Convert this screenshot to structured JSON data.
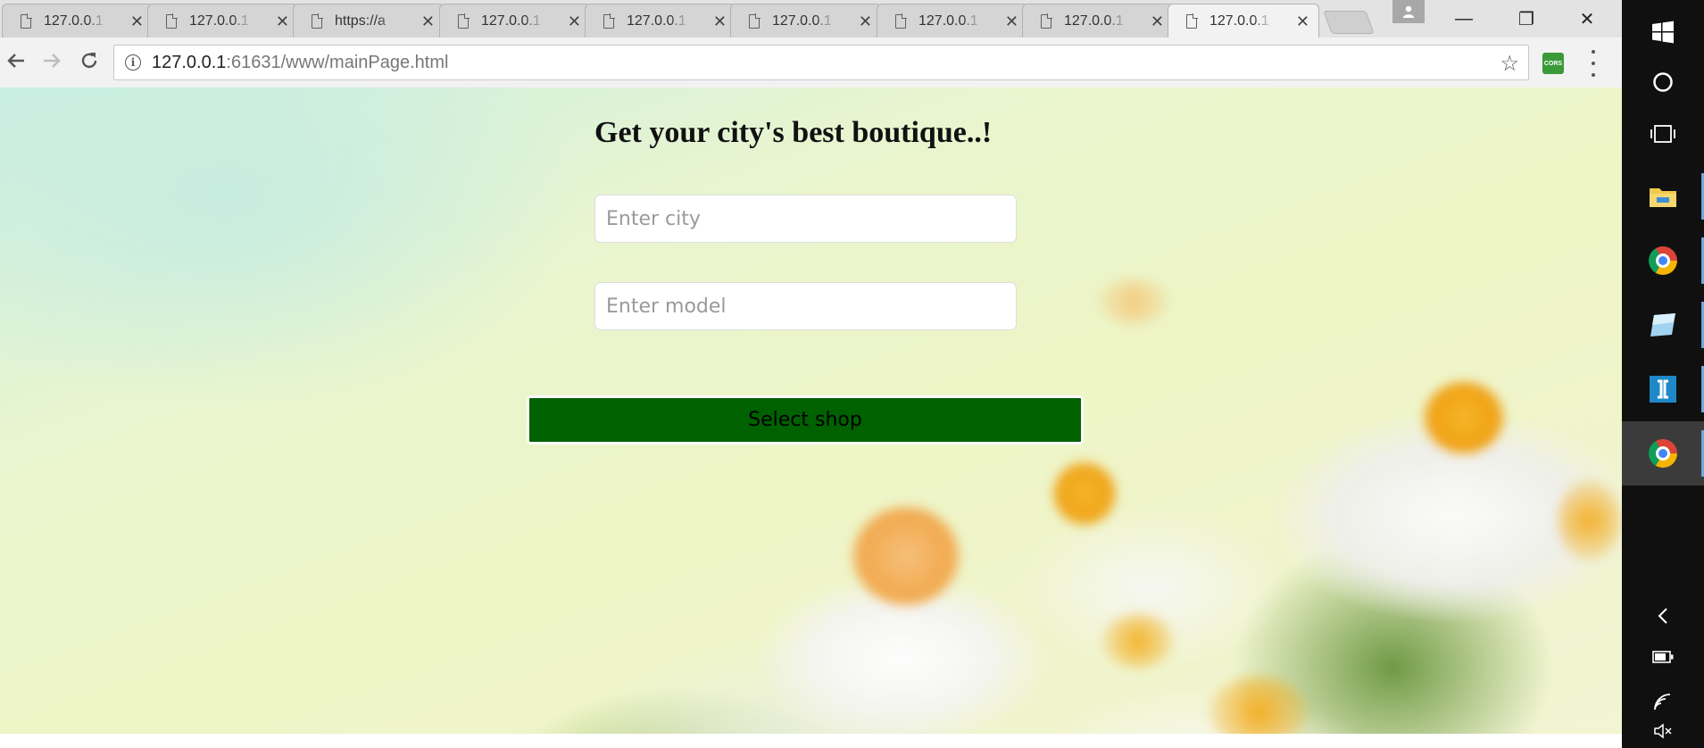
{
  "browser": {
    "tabs": [
      {
        "title": "127.0.0.1"
      },
      {
        "title": "127.0.0.1"
      },
      {
        "title": "https://a"
      },
      {
        "title": "127.0.0.1"
      },
      {
        "title": "127.0.0.1"
      },
      {
        "title": "127.0.0.1"
      },
      {
        "title": "127.0.0.1"
      },
      {
        "title": "127.0.0.1"
      },
      {
        "title": "127.0.0.1",
        "active": true
      }
    ],
    "tab_close_glyph": "✕",
    "url_host": "127.0.0.1",
    "url_rest": ":61631/www/mainPage.html",
    "extension_label": "CORS",
    "window_controls": {
      "minimize": "—",
      "restore": "❐",
      "close": "✕"
    }
  },
  "page": {
    "title": "Get your city's best boutique..!",
    "city_placeholder": "Enter city",
    "model_placeholder": "Enter model",
    "select_button": "Select shop",
    "button_color": "#006100"
  },
  "taskbar": {
    "items": [
      "windows-start",
      "cortana",
      "task-view",
      "file-explorer",
      "chrome",
      "app-blue",
      "app-bracket",
      "chrome-active"
    ],
    "tray": [
      "back-chevron",
      "battery",
      "wifi",
      "volume-mute"
    ]
  }
}
